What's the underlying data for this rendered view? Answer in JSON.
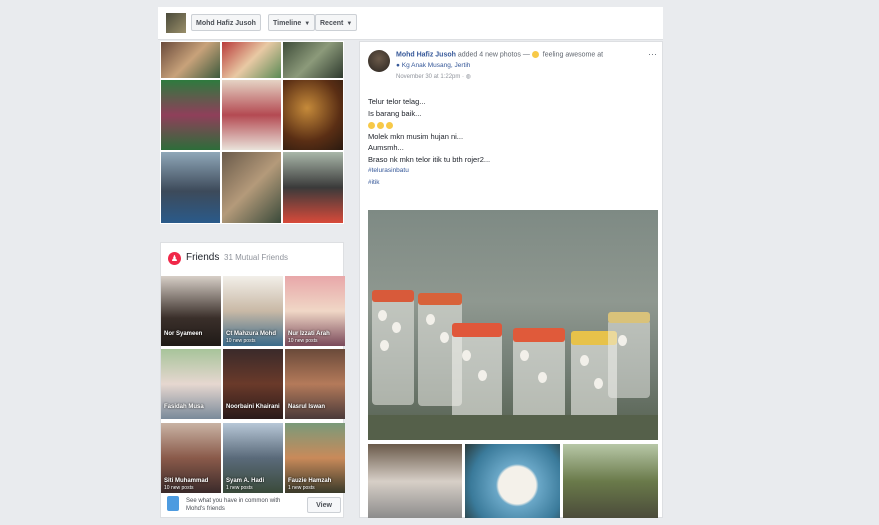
{
  "topbar": {
    "profile_name": "Mohd Hafiz Jusoh",
    "timeline_label": "Timeline",
    "recent_label": "Recent"
  },
  "friends": {
    "title": "Friends",
    "count": "31 Mutual Friends",
    "tiles": [
      {
        "name": "Nor Syameen",
        "sub": ""
      },
      {
        "name": "Ct Mahzura Mohd",
        "sub": "10 new posts"
      },
      {
        "name": "Nur Izzati Arah",
        "sub": "10 new posts"
      },
      {
        "name": "Fasidah Musa",
        "sub": ""
      },
      {
        "name": "Noorbaini Khairani",
        "sub": ""
      },
      {
        "name": "Nasrul Iswan",
        "sub": ""
      },
      {
        "name": "Siti Muhammad",
        "sub": "10 new posts"
      },
      {
        "name": "Syam A. Hadi",
        "sub": "1 new posts"
      },
      {
        "name": "Fauzie Hamzah",
        "sub": "1 new posts"
      }
    ],
    "see_text": "See what you have in common with Mohd's friends",
    "view_label": "View"
  },
  "post": {
    "author": "Mohd Hafiz Jusoh",
    "action": "added 4 new photos —",
    "feeling": "feeling awesome at",
    "location": "Kg Anak Musang, Jertih",
    "time": "November 30 at 1:22pm · ",
    "lines": [
      "Telur telor telag...",
      "Is barang baik...",
      "",
      "Molek mkn musim hujan ni...",
      "Aumsmh...",
      "Braso nk mkn telor itik tu bth rojer2..."
    ],
    "hashtag": "#telurasinbatu",
    "hashtag2": "#itik",
    "more": "···"
  },
  "icons": {
    "friends": "friends-icon",
    "location": "location-pin-icon",
    "globe": "globe-icon",
    "feeling": "smiley-icon",
    "more": "more-options-icon"
  }
}
